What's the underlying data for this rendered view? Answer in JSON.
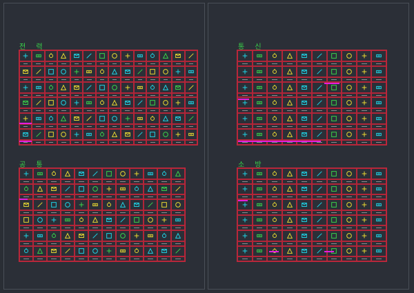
{
  "sections": {
    "power": {
      "title": "전 력"
    },
    "telecom": {
      "title": "통 신"
    },
    "common": {
      "title": "공 통"
    },
    "fire": {
      "title": "소 방"
    }
  },
  "colors": {
    "background": "#2a2e35",
    "grid_line": "#c0283c",
    "title": "#39d34a",
    "highlight": "#e21ee0",
    "symbol_cyan": "#1fd3e6",
    "symbol_yellow": "#e8d832",
    "symbol_green": "#39d34a"
  }
}
